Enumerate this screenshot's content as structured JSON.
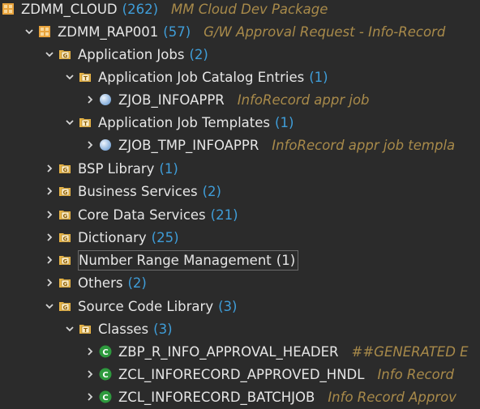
{
  "tree": {
    "root": {
      "label": "ZDMM_CLOUD",
      "count": "(262)",
      "desc": "MM Cloud Dev Package"
    },
    "pkg": {
      "label": "ZDMM_RAP001",
      "count": "(57)",
      "desc": "G/W Approval Request - Info-Record"
    },
    "app_jobs": {
      "label": "Application Jobs",
      "count": "(2)"
    },
    "catalog": {
      "label": "Application Job Catalog Entries",
      "count": "(1)"
    },
    "catalog_item": {
      "label": "ZJOB_INFOAPPR",
      "desc": "InfoRecord appr job"
    },
    "templates": {
      "label": "Application Job Templates",
      "count": "(1)"
    },
    "template_item": {
      "label": "ZJOB_TMP_INFOAPPR",
      "desc": "InfoRecord appr job templa"
    },
    "bsp": {
      "label": "BSP Library",
      "count": "(1)"
    },
    "business": {
      "label": "Business Services",
      "count": "(2)"
    },
    "cds": {
      "label": "Core Data Services",
      "count": "(21)"
    },
    "dictionary": {
      "label": "Dictionary",
      "count": "(25)"
    },
    "number_range": {
      "label": "Number Range Management",
      "count": "(1)"
    },
    "others": {
      "label": "Others",
      "count": "(2)"
    },
    "source": {
      "label": "Source Code Library",
      "count": "(3)"
    },
    "classes": {
      "label": "Classes",
      "count": "(3)"
    },
    "class1": {
      "label": "ZBP_R_INFO_APPROVAL_HEADER",
      "desc": "##GENERATED E"
    },
    "class2": {
      "label": "ZCL_INFORECORD_APPROVED_HNDL",
      "desc": "Info Record"
    },
    "class3": {
      "label": "ZCL_INFORECORD_BATCHJOB",
      "desc": "Info Record Approv"
    }
  },
  "colors": {
    "background": "#2b2b2b",
    "count": "#3f9dd8",
    "description": "#a88a4a",
    "package_icon": "#e8a33d",
    "folder_icon": "#e9b547",
    "class_icon": "#2e9a3e",
    "job_icon": "#a9c9ec"
  },
  "icons": {
    "package": "package-icon",
    "folder_g": "folder-g-icon",
    "folder_t": "folder-t-icon",
    "job": "job-icon",
    "class": "class-icon"
  }
}
